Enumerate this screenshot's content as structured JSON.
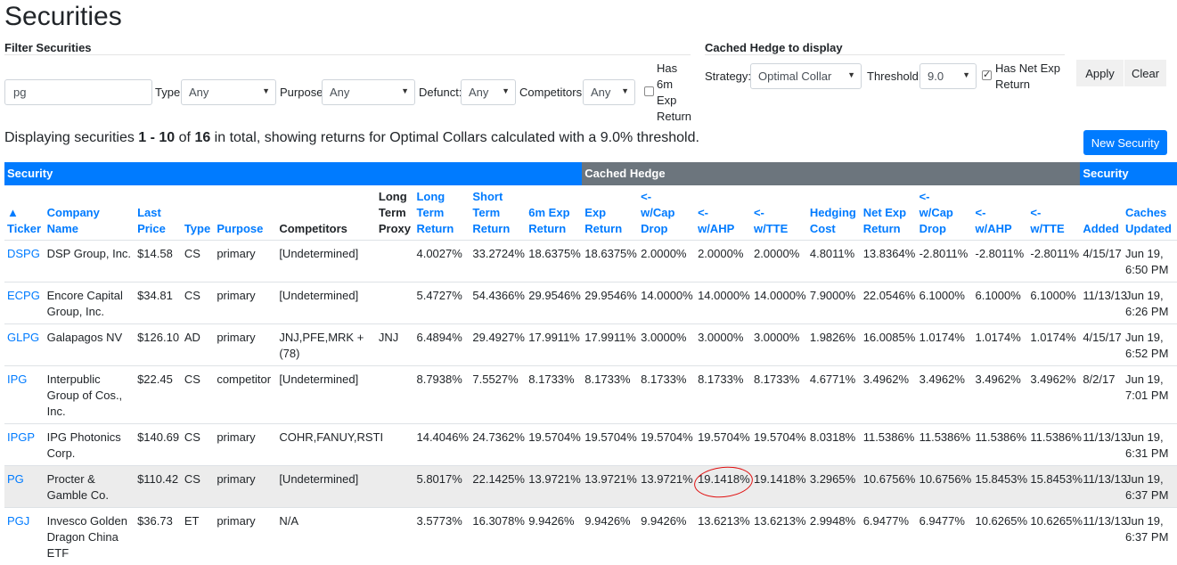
{
  "page": {
    "title": "Securities"
  },
  "filters": {
    "section_label": "Filter Securities",
    "search_value": "pg",
    "type_label": "Type:",
    "type_value": "Any",
    "purpose_label": "Purpose:",
    "purpose_value": "Any",
    "defunct_label": "Defunct:",
    "defunct_value": "Any",
    "competitors_label": "Competitors:",
    "competitors_value": "Any",
    "has_6m_label_lines": [
      "Has",
      "6m",
      "Exp",
      "Return"
    ]
  },
  "cached_hedge": {
    "section_label": "Cached Hedge to display",
    "strategy_label": "Strategy:",
    "strategy_value": "Optimal Collar",
    "threshold_label": "Threshold:",
    "threshold_value": "9.0",
    "has_net_label_lines": [
      "Has Net Exp",
      "Return"
    ],
    "apply_label": "Apply",
    "clear_label": "Clear"
  },
  "summary": {
    "prefix": "Displaying securities ",
    "range": "1 - 10",
    "of": " of ",
    "total": "16",
    "suffix": " in total, showing returns for Optimal Collars calculated with a 9.0% threshold."
  },
  "new_security_label": "New Security",
  "table": {
    "groups": [
      {
        "label": "Security",
        "span": 9,
        "color": "blue"
      },
      {
        "label": "Cached Hedge",
        "span": 9,
        "color": "gray"
      },
      {
        "label": "Security",
        "span": 2,
        "color": "blue"
      }
    ],
    "columns": [
      {
        "lines": [
          "▲",
          "Ticker"
        ],
        "link": true
      },
      {
        "lines": [
          "Company",
          "Name"
        ],
        "link": true
      },
      {
        "lines": [
          "Last",
          "Price"
        ],
        "link": true
      },
      {
        "lines": [
          "Type"
        ],
        "link": true
      },
      {
        "lines": [
          "Purpose"
        ],
        "link": true
      },
      {
        "lines": [
          "Competitors"
        ],
        "link": false
      },
      {
        "lines": [
          "Long",
          "Term",
          "Proxy"
        ],
        "link": false
      },
      {
        "lines": [
          "Long",
          "Term",
          "Return"
        ],
        "link": true
      },
      {
        "lines": [
          "Short",
          "Term",
          "Return"
        ],
        "link": true
      },
      {
        "lines": [
          "6m Exp",
          "Return"
        ],
        "link": true
      },
      {
        "lines": [
          "Exp",
          "Return"
        ],
        "link": true
      },
      {
        "lines": [
          "<-",
          "w/Cap",
          "Drop"
        ],
        "link": true
      },
      {
        "lines": [
          "<-",
          "w/AHP"
        ],
        "link": true
      },
      {
        "lines": [
          "<-",
          "w/TTE"
        ],
        "link": true
      },
      {
        "lines": [
          "Hedging",
          "Cost"
        ],
        "link": true
      },
      {
        "lines": [
          "Net Exp",
          "Return"
        ],
        "link": true
      },
      {
        "lines": [
          "<-",
          "w/Cap",
          "Drop"
        ],
        "link": true
      },
      {
        "lines": [
          "<-",
          "w/AHP"
        ],
        "link": true
      },
      {
        "lines": [
          "<-",
          "w/TTE"
        ],
        "link": true
      },
      {
        "lines": [
          "Added"
        ],
        "link": true
      },
      {
        "lines": [
          "Caches",
          "Updated"
        ],
        "link": true
      }
    ],
    "rows": [
      [
        "DSPG",
        "DSP Group, Inc.",
        "$14.58",
        "CS",
        "primary",
        "[Undetermined]",
        "",
        "4.0027%",
        "33.2724%",
        "18.6375%",
        "18.6375%",
        "2.0000%",
        "2.0000%",
        "2.0000%",
        "4.8011%",
        "13.8364%",
        "-2.8011%",
        "-2.8011%",
        "-2.8011%",
        "4/15/17",
        "Jun 19, 6:50 PM"
      ],
      [
        "ECPG",
        "Encore Capital Group, Inc.",
        "$34.81",
        "CS",
        "primary",
        "[Undetermined]",
        "",
        "5.4727%",
        "54.4366%",
        "29.9546%",
        "29.9546%",
        "14.0000%",
        "14.0000%",
        "14.0000%",
        "7.9000%",
        "22.0546%",
        "6.1000%",
        "6.1000%",
        "6.1000%",
        "11/13/13",
        "Jun 19, 6:26 PM"
      ],
      [
        "GLPG",
        "Galapagos NV",
        "$126.10",
        "AD",
        "primary",
        "JNJ,PFE,MRK + (78)",
        "JNJ",
        "6.4894%",
        "29.4927%",
        "17.9911%",
        "17.9911%",
        "3.0000%",
        "3.0000%",
        "3.0000%",
        "1.9826%",
        "16.0085%",
        "1.0174%",
        "1.0174%",
        "1.0174%",
        "4/15/17",
        "Jun 19, 6:52 PM"
      ],
      [
        "IPG",
        "Interpublic Group of Cos., Inc.",
        "$22.45",
        "CS",
        "competitor",
        "[Undetermined]",
        "",
        "8.7938%",
        "7.5527%",
        "8.1733%",
        "8.1733%",
        "8.1733%",
        "8.1733%",
        "8.1733%",
        "4.6771%",
        "3.4962%",
        "3.4962%",
        "3.4962%",
        "3.4962%",
        "8/2/17",
        "Jun 19, 7:01 PM"
      ],
      [
        "IPGP",
        "IPG Photonics Corp.",
        "$140.69",
        "CS",
        "primary",
        "COHR,FANUY,RSTI",
        "",
        "14.4046%",
        "24.7362%",
        "19.5704%",
        "19.5704%",
        "19.5704%",
        "19.5704%",
        "19.5704%",
        "8.0318%",
        "11.5386%",
        "11.5386%",
        "11.5386%",
        "11.5386%",
        "11/13/13",
        "Jun 19, 6:31 PM"
      ],
      [
        "PG",
        "Procter & Gamble Co.",
        "$110.42",
        "CS",
        "primary",
        "[Undetermined]",
        "",
        "5.8017%",
        "22.1425%",
        "13.9721%",
        "13.9721%",
        "13.9721%",
        "19.1418%",
        "19.1418%",
        "3.2965%",
        "10.6756%",
        "10.6756%",
        "15.8453%",
        "15.8453%",
        "11/13/13",
        "Jun 19, 6:37 PM"
      ],
      [
        "PGJ",
        "Invesco Golden Dragon China ETF",
        "$36.73",
        "ET",
        "primary",
        "N/A",
        "",
        "3.5773%",
        "16.3078%",
        "9.9426%",
        "9.9426%",
        "9.9426%",
        "13.6213%",
        "13.6213%",
        "2.9948%",
        "6.9477%",
        "6.9477%",
        "10.6265%",
        "10.6265%",
        "11/13/13",
        "Jun 19, 6:37 PM"
      ]
    ]
  },
  "colors": {
    "primary": "#007bff",
    "gray_group": "#6c757d",
    "highlight_row": "#ececec",
    "annotation": "#e01010"
  }
}
